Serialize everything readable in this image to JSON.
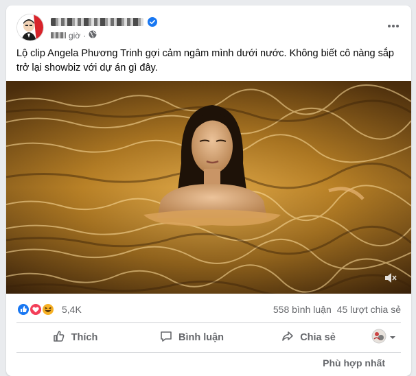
{
  "post": {
    "time": "giờ",
    "separator": "·",
    "text": "Lộ clip Angela Phương Trinh gợi cảm ngâm mình dưới nước. Không biết cô nàng sắp trở lại showbiz với dự án gì đây."
  },
  "stats": {
    "reactions": "5,4K",
    "comments": "558 bình luận",
    "shares": "45 lượt chia sẻ"
  },
  "actions": {
    "like": "Thích",
    "comment": "Bình luận",
    "share": "Chia sẻ"
  },
  "sort": {
    "label": "Phù hợp nhất"
  },
  "colors": {
    "like_blue": "#1877f2",
    "love_red": "#f33e58",
    "haha_yellow": "#f7b125",
    "verified_blue": "#1877f2"
  },
  "icons": [
    "verified-badge-icon",
    "globe-icon",
    "more-options-icon",
    "mute-icon",
    "like-icon",
    "comment-icon",
    "share-icon",
    "chevron-down-icon"
  ]
}
